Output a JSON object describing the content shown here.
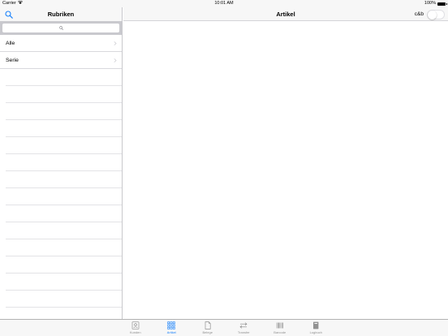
{
  "status_bar": {
    "carrier": "Carrier",
    "time": "10:01 AM",
    "battery": "100%"
  },
  "sidebar": {
    "title": "Rubriken",
    "search_placeholder": "",
    "items": [
      {
        "label": "Alle"
      },
      {
        "label": "Serie"
      }
    ]
  },
  "detail": {
    "title": "Artikel",
    "toggle_label": "c&b",
    "toggle_on": false
  },
  "tabs": [
    {
      "label": "Kunden",
      "icon": "contacts-icon",
      "active": false
    },
    {
      "label": "Artikel",
      "icon": "grid-icon",
      "active": true
    },
    {
      "label": "Belege",
      "icon": "document-icon",
      "active": false
    },
    {
      "label": "Transfer",
      "icon": "transfer-icon",
      "active": false
    },
    {
      "label": "Barcode",
      "icon": "barcode-icon",
      "active": false
    },
    {
      "label": "Logbuch",
      "icon": "logbook-icon",
      "active": false
    }
  ],
  "colors": {
    "accent": "#1a82fb",
    "inactive_tab": "#929292",
    "bar_background": "#f7f7f7"
  }
}
